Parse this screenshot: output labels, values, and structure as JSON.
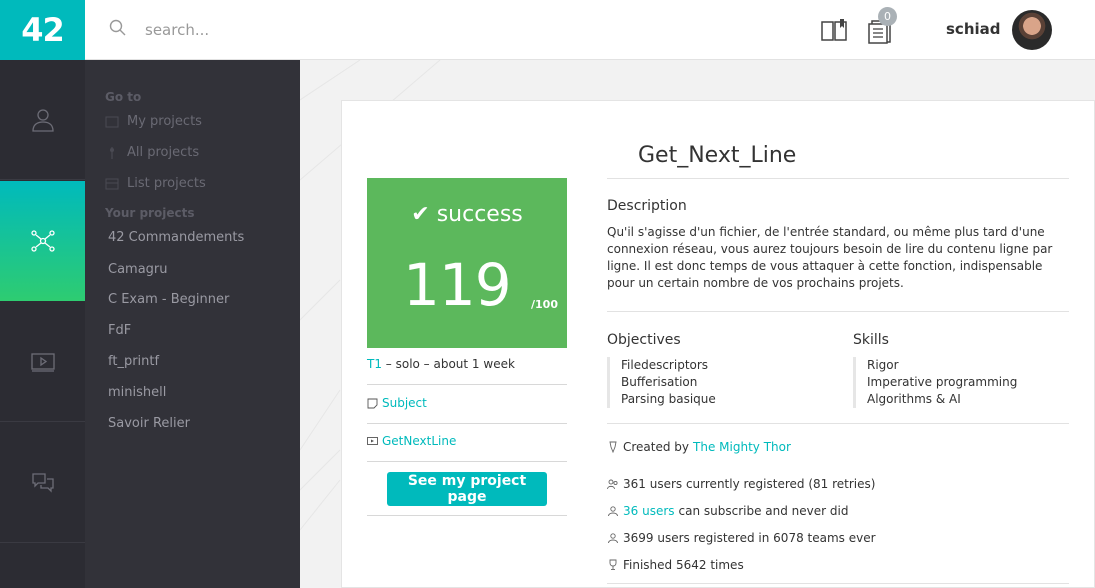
{
  "logo": {
    "text": "42"
  },
  "search": {
    "placeholder": "search..."
  },
  "header": {
    "notifications_count": "0",
    "username": "schiad"
  },
  "submenu": {
    "goto_heading": "Go to",
    "goto_links": [
      "My projects",
      "All projects",
      "List projects"
    ],
    "your_projects_heading": "Your projects",
    "projects": [
      "42 Commandements",
      "Camagru",
      "C Exam - Beginner",
      "FdF",
      "ft_printf",
      "minishell",
      "Savoir Relier"
    ]
  },
  "project": {
    "title": "Get_Next_Line",
    "status": "success",
    "score": "119",
    "score_max": "/100",
    "tier": "T1",
    "meta_rest": " – solo – about 1 week",
    "subject_link": "Subject",
    "repo_link": "GetNextLine",
    "cta": "See my project page",
    "description_title": "Description",
    "description": "Qu'il s'agisse d'un fichier, de l'entrée standard, ou même plus tard d'une connexion réseau, vous aurez toujours besoin de lire du contenu ligne par ligne. Il est donc temps de vous attaquer à cette fonction, indispensable pour un certain nombre de vos prochains projets.",
    "objectives_title": "Objectives",
    "objectives": [
      "Filedescriptors",
      "Bufferisation",
      "Parsing basique"
    ],
    "skills_title": "Skills",
    "skills": [
      "Rigor",
      "Imperative programming",
      "Algorithms & AI"
    ],
    "created_prefix": "Created by ",
    "creator": "The Mighty Thor",
    "registered": "361 users currently registered (81 retries)",
    "can_subscribe_link": "36 users",
    "can_subscribe_rest": " can subscribe and never did",
    "ever_registered": "3699 users registered in 6078 teams ever",
    "finished": "Finished 5642 times"
  },
  "colors": {
    "accent": "#00babc",
    "success": "#5cb85c",
    "rail": "#2c2c33",
    "submenu": "#323239"
  }
}
